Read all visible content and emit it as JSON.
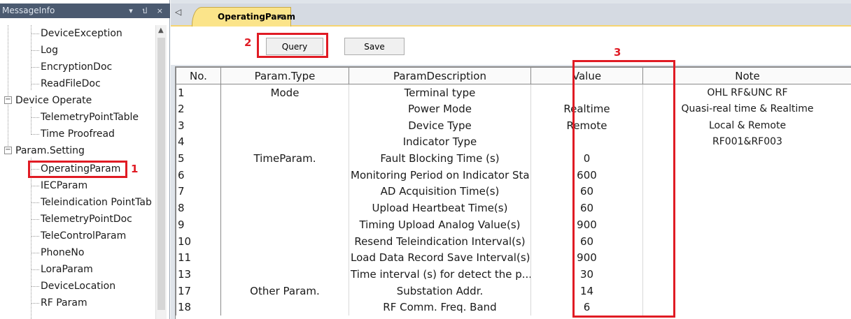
{
  "left_panel": {
    "title": "MessageInfo",
    "controls": "▾ ป ×",
    "tree": {
      "items": [
        {
          "label": "DeviceException"
        },
        {
          "label": "Log"
        },
        {
          "label": "EncryptionDoc"
        },
        {
          "label": "ReadFileDoc"
        },
        {
          "label": "Device Operate",
          "expander": "−"
        },
        {
          "label": "TelemetryPointTable"
        },
        {
          "label": "Time Proofread"
        },
        {
          "label": "Param.Setting",
          "expander": "−"
        },
        {
          "label": "OperatingParam"
        },
        {
          "label": "IECParam"
        },
        {
          "label": "Teleindication PointTab"
        },
        {
          "label": "TelemetryPointDoc"
        },
        {
          "label": "TeleControlParam"
        },
        {
          "label": "PhoneNo"
        },
        {
          "label": "LoraParam"
        },
        {
          "label": "DeviceLocation"
        },
        {
          "label": "RF Param"
        }
      ]
    }
  },
  "tabs": {
    "nav_arrow": "◁",
    "items": [
      {
        "label": "OperatingParam",
        "close": "×"
      }
    ]
  },
  "toolbar": {
    "query_label": "Query",
    "save_label": "Save"
  },
  "annotations": {
    "n1": "1",
    "n2": "2",
    "n3": "3"
  },
  "grid": {
    "headers": [
      "No.",
      "Param.Type",
      "ParamDescription",
      "Value",
      "Note"
    ],
    "rows": [
      [
        "1",
        "Mode",
        "Terminal type",
        "",
        "OHL RF&UNC RF"
      ],
      [
        "2",
        "",
        "Power Mode",
        "Realtime",
        "Quasi-real time & Realtime"
      ],
      [
        "3",
        "",
        "Device Type",
        "Remote",
        "Local & Remote"
      ],
      [
        "4",
        "",
        "Indicator Type",
        "",
        "RF001&RF003"
      ],
      [
        "5",
        "TimeParam.",
        "Fault Blocking Time (s)",
        "0",
        ""
      ],
      [
        "6",
        "",
        "Monitoring Period on Indicator Sta...",
        "600",
        ""
      ],
      [
        "7",
        "",
        "AD Acquisition Time(s)",
        "60",
        ""
      ],
      [
        "8",
        "",
        "Upload Heartbeat Time(s)",
        "60",
        ""
      ],
      [
        "9",
        "",
        "Timing Upload Analog Value(s)",
        "900",
        ""
      ],
      [
        "10",
        "",
        "Resend Teleindication Interval(s)",
        "60",
        ""
      ],
      [
        "11",
        "",
        "Load Data Record Save Interval(s)",
        "900",
        ""
      ],
      [
        "13",
        "",
        "Time interval (s) for detect the p...",
        "30",
        ""
      ],
      [
        "17",
        "Other Param.",
        "Substation Addr.",
        "14",
        ""
      ],
      [
        "18",
        "",
        "RF Comm. Freq. Band",
        "6",
        ""
      ]
    ]
  },
  "colors": {
    "highlight": "#e01b24",
    "tab_active": "#fbe48a",
    "panel_header": "#4b5a70"
  }
}
